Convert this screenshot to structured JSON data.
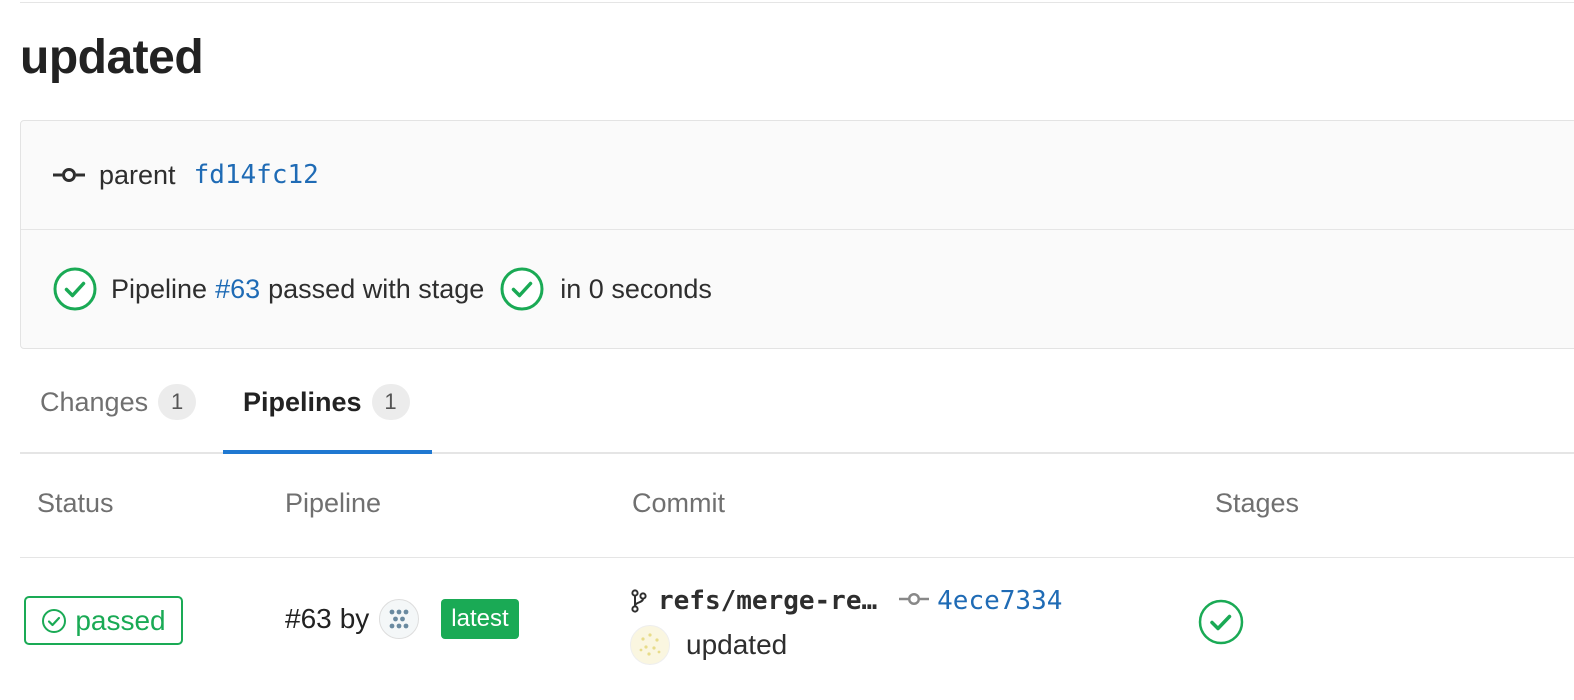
{
  "title": "updated",
  "parent": {
    "label": "parent",
    "sha": "fd14fc12"
  },
  "pipeline_summary": {
    "prefix": "Pipeline",
    "id": "#63",
    "middle": "passed with stage",
    "suffix": "in 0 seconds"
  },
  "tabs": [
    {
      "label": "Changes",
      "count": "1"
    },
    {
      "label": "Pipelines",
      "count": "1"
    }
  ],
  "table": {
    "headers": {
      "status": "Status",
      "pipeline": "Pipeline",
      "commit": "Commit",
      "stages": "Stages"
    },
    "row": {
      "status": "passed",
      "pipeline_id": "#63",
      "by": "by",
      "latest": "latest",
      "ref": "refs/merge-re…",
      "sha": "4ece7334",
      "message": "updated"
    }
  },
  "colors": {
    "success": "#1aaa55",
    "link": "#1f6bb5",
    "tab_active": "#1f78d1"
  }
}
